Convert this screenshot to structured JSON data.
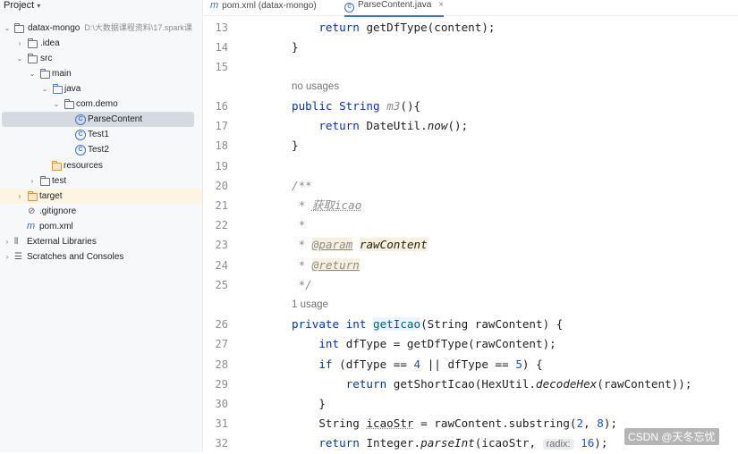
{
  "sidebar": {
    "title": "Project",
    "project_name": "datax-mongo",
    "project_path": "D:\\大数据课程资料\\17.spark课",
    "items": {
      "idea": ".idea",
      "src": "src",
      "main": "main",
      "java": "java",
      "package": "com.demo",
      "parse_content": "ParseContent",
      "test1": "Test1",
      "test2": "Test2",
      "resources": "resources",
      "test": "test",
      "target": "target",
      "gitignore": ".gitignore",
      "pom": "pom.xml",
      "external_libraries": "External Libraries",
      "scratches": "Scratches and Consoles"
    }
  },
  "tabs": {
    "pom_label": "pom.xml (datax-mongo)",
    "parse_label": "ParseContent.java",
    "close": "×"
  },
  "editor": {
    "line_numbers": [
      "13",
      "14",
      "15",
      "16",
      "17",
      "18",
      "19",
      "20",
      "21",
      "22",
      "23",
      "24",
      "25",
      "26",
      "27",
      "28",
      "29",
      "30",
      "31",
      "32"
    ],
    "hints": {
      "no_usages": "no usages",
      "one_usage": "1 usage"
    },
    "l13": {
      "kw": "return",
      "rest": "getDfType(content);"
    },
    "l14": "}",
    "l16": {
      "kw1": "public",
      "type": "String",
      "name": "m3",
      "rest": "(){"
    },
    "l17": {
      "kw": "return",
      "cls": "DateUtil.",
      "call": "now",
      "rest": "();"
    },
    "l18": "}",
    "l20": "/**",
    "l21": {
      "star": "*",
      "text": "获取icao"
    },
    "l22": "*",
    "l23": {
      "star": "*",
      "tag": "@param",
      "param": "rawContent"
    },
    "l24": {
      "star": "*",
      "tag": "@return"
    },
    "l25": "*/",
    "l26": {
      "kw1": "private",
      "kw2": "int",
      "name": "getIcao",
      "rest": "(String rawContent) {"
    },
    "l27": {
      "kw": "int",
      "rest": "dfType = getDfType(rawContent);"
    },
    "l28": {
      "kw": "if",
      "a": "(dfType ==",
      "n1": "4",
      "b": "|| dfType ==",
      "n2": "5",
      "c": ") {"
    },
    "l29": {
      "kw": "return",
      "a": "getShortIcao(HexUtil.",
      "call": "decodeHex",
      "b": "(rawContent));"
    },
    "l30": "}",
    "l31": {
      "a": "String",
      "var": "icaoStr",
      "b": "= rawContent.substring(",
      "n1": "2",
      "c": ",",
      "n2": "8",
      "d": ");"
    },
    "l32": {
      "kw": "return",
      "a": "Integer.",
      "call": "parseInt",
      "b": "(icaoStr,",
      "inlay": "radix:",
      "n": "16",
      "c": ");"
    }
  },
  "watermark": "CSDN @天冬忘忧"
}
